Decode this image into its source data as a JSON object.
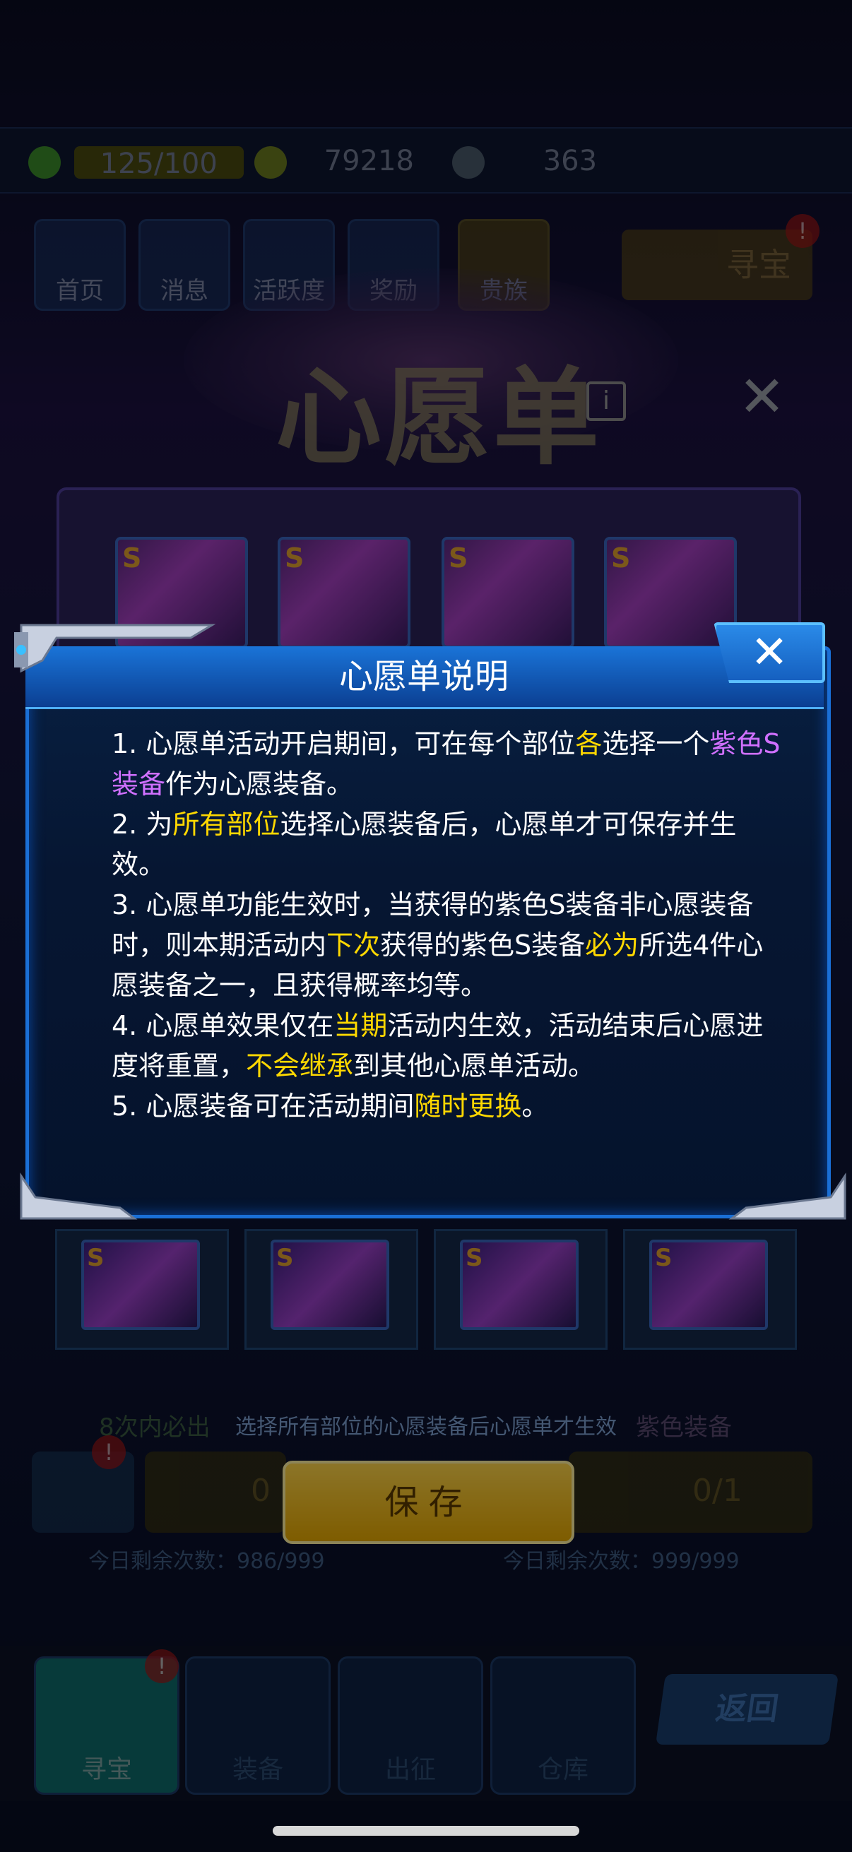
{
  "resources": {
    "energy": "125/100",
    "coins": "79218",
    "gems": "363"
  },
  "nav_tabs": [
    {
      "label": "首页"
    },
    {
      "label": "消息"
    },
    {
      "label": "活跃度"
    },
    {
      "label": "奖励"
    },
    {
      "label": "贵族"
    }
  ],
  "treasure_button": {
    "label": "寻宝",
    "badge": "!"
  },
  "panel": {
    "title": "心愿单",
    "info_icon": "info-icon",
    "close_icon": "close-icon",
    "slot_grade": "S",
    "hint": "选择所有部位的心愿装备后心愿单才生效",
    "count_text": "8次内必出",
    "count_text_right": "紫色装备",
    "save_label": "保存",
    "left_remaining": "今日剩余次数：986/999",
    "right_remaining": "今日剩余次数：999/999",
    "right_key_count": "0/1",
    "left_key_count": "0"
  },
  "bottom_nav": {
    "items": [
      {
        "label": "寻宝"
      },
      {
        "label": "装备"
      },
      {
        "label": "出征"
      },
      {
        "label": "仓库"
      }
    ],
    "back_label": "返回"
  },
  "dialog": {
    "title": "心愿单说明",
    "close_icon": "close-icon",
    "rules": [
      {
        "parts": [
          {
            "t": "1. 心愿单活动开启期间，可在每个部位",
            "c": "w"
          },
          {
            "t": "各",
            "c": "y"
          },
          {
            "t": "选择一个",
            "c": "w"
          },
          {
            "t": "紫色S装备",
            "c": "p"
          },
          {
            "t": "作为心愿装备。",
            "c": "w"
          }
        ]
      },
      {
        "parts": [
          {
            "t": "2. 为",
            "c": "w"
          },
          {
            "t": "所有部位",
            "c": "y"
          },
          {
            "t": "选择心愿装备后，心愿单才可保存并生效。",
            "c": "w"
          }
        ]
      },
      {
        "parts": [
          {
            "t": "3. 心愿单功能生效时，当获得的紫色S装备非心愿装备时，则本期活动内",
            "c": "w"
          },
          {
            "t": "下次",
            "c": "y"
          },
          {
            "t": "获得的紫色S装备",
            "c": "w"
          },
          {
            "t": "必为",
            "c": "y"
          },
          {
            "t": "所选4件心愿装备之一，且获得概率均等。",
            "c": "w"
          }
        ]
      },
      {
        "parts": [
          {
            "t": "4. 心愿单效果仅在",
            "c": "w"
          },
          {
            "t": "当期",
            "c": "y"
          },
          {
            "t": "活动内生效，活动结束后心愿进度将重置，",
            "c": "w"
          },
          {
            "t": "不会继承",
            "c": "y"
          },
          {
            "t": "到其他心愿单活动。",
            "c": "w"
          }
        ]
      },
      {
        "parts": [
          {
            "t": "5. 心愿装备可在活动期间",
            "c": "w"
          },
          {
            "t": "随时更换",
            "c": "y"
          },
          {
            "t": "。",
            "c": "w"
          }
        ]
      }
    ]
  },
  "colors": {
    "highlight_yellow": "#ffd800",
    "highlight_purple": "#d070ff",
    "dialog_border": "#1a6fd6",
    "save_button": "#ffd54a"
  }
}
